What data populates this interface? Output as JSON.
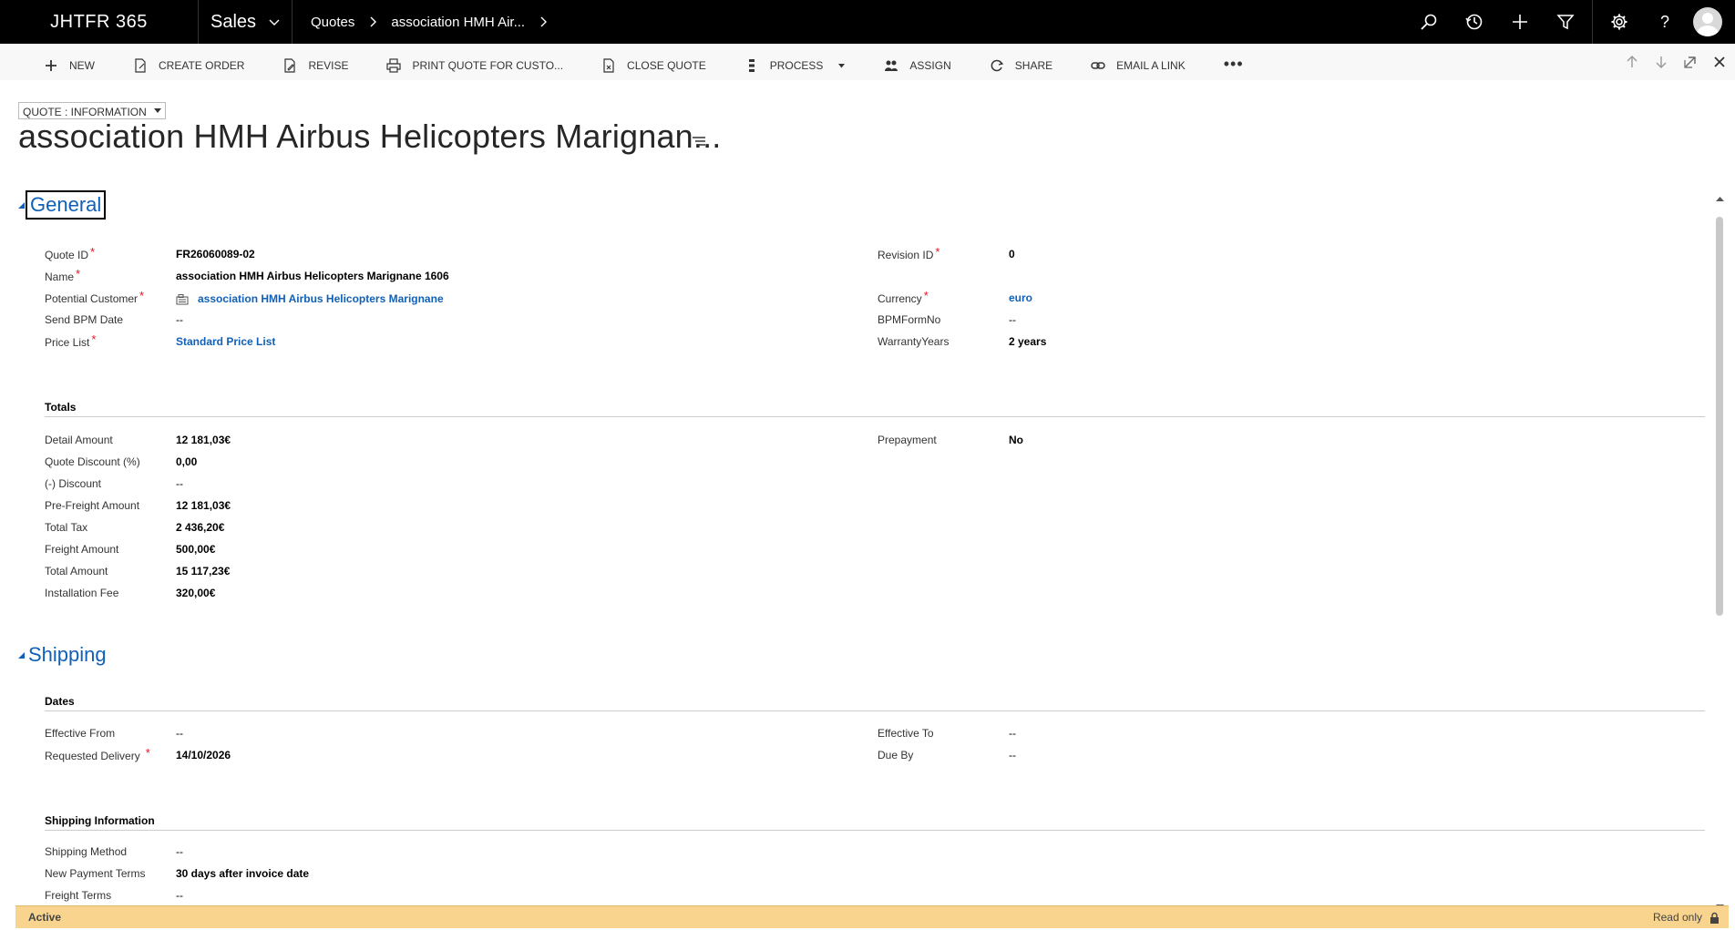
{
  "app": {
    "brand": "JHTFR 365",
    "module": "Sales",
    "breadcrumb": [
      "Quotes",
      "association HMH Air..."
    ]
  },
  "commands": [
    {
      "label": "NEW",
      "icon": "plus-icon"
    },
    {
      "label": "CREATE ORDER",
      "icon": "document-edit-icon"
    },
    {
      "label": "REVISE",
      "icon": "revise-icon"
    },
    {
      "label": "PRINT QUOTE FOR CUSTO...",
      "icon": "print-icon"
    },
    {
      "label": "CLOSE QUOTE",
      "icon": "close-document-icon"
    },
    {
      "label": "PROCESS",
      "icon": "process-icon"
    },
    {
      "label": "ASSIGN",
      "icon": "assign-icon"
    },
    {
      "label": "SHARE",
      "icon": "share-icon"
    },
    {
      "label": "EMAIL A LINK",
      "icon": "link-icon"
    }
  ],
  "form": {
    "selector": "QUOTE : INFORMATION",
    "title": "association HMH Airbus Helicopters Marignan..."
  },
  "general": {
    "heading": "General",
    "quote_id_label": "Quote ID",
    "quote_id": "FR26060089-02",
    "name_label": "Name",
    "name": "association HMH Airbus Helicopters Marignane 1606",
    "customer_label": "Potential Customer",
    "customer": "association HMH Airbus Helicopters Marignane",
    "send_bpm_label": "Send BPM Date",
    "send_bpm": "--",
    "price_list_label": "Price List",
    "price_list": "Standard Price List",
    "revision_label": "Revision ID",
    "revision": "0",
    "currency_label": "Currency",
    "currency": "euro",
    "bpm_form_label": "BPMFormNo",
    "bpm_form": "--",
    "warranty_label": "WarrantyYears",
    "warranty": "2 years"
  },
  "totals": {
    "heading": "Totals",
    "detail_amount_label": "Detail Amount",
    "detail_amount": "12 181,03€",
    "quote_discount_label": "Quote Discount (%)",
    "quote_discount": "0,00",
    "discount_label": "(-) Discount",
    "discount": "--",
    "pre_freight_label": "Pre-Freight Amount",
    "pre_freight": "12 181,03€",
    "total_tax_label": "Total Tax",
    "total_tax": "2 436,20€",
    "freight_label": "Freight Amount",
    "freight": "500,00€",
    "total_amount_label": "Total Amount",
    "total_amount": "15 117,23€",
    "installation_label": "Installation Fee",
    "installation": "320,00€",
    "prepayment_label": "Prepayment",
    "prepayment": "No"
  },
  "shipping": {
    "heading": "Shipping",
    "dates_heading": "Dates",
    "effective_from_label": "Effective From",
    "effective_from": "--",
    "requested_delivery_label": "Requested Delivery",
    "requested_delivery": "14/10/2026",
    "effective_to_label": "Effective To",
    "effective_to": "--",
    "due_by_label": "Due By",
    "due_by": "--",
    "info_heading": "Shipping Information",
    "method_label": "Shipping Method",
    "method": "--",
    "payment_terms_label": "New Payment Terms",
    "payment_terms": "30 days after invoice date",
    "freight_terms_label": "Freight Terms",
    "freight_terms": "--"
  },
  "status": {
    "state": "Active",
    "mode": "Read only"
  },
  "colors": {
    "topbar": "#000000",
    "link": "#1160b7",
    "required": "#e81123",
    "statusbar": "#f8d48f"
  }
}
